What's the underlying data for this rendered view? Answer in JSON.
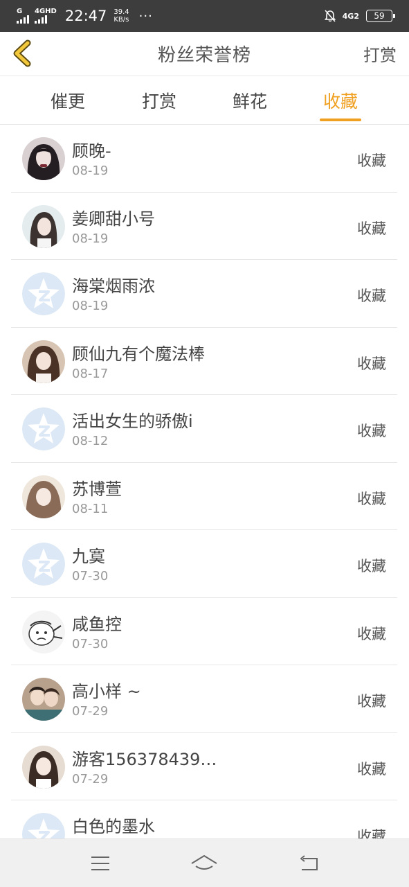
{
  "status_bar": {
    "sim1": "G",
    "sim2": "4GHD",
    "time": "22:47",
    "speed_value": "39.4",
    "speed_unit": "KB/s",
    "more": "···",
    "net": "4G2",
    "battery": "59"
  },
  "header": {
    "title": "粉丝荣誉榜",
    "action": "打赏"
  },
  "tabs": [
    {
      "label": "催更"
    },
    {
      "label": "打赏"
    },
    {
      "label": "鲜花"
    },
    {
      "label": "收藏",
      "active": true
    }
  ],
  "list": [
    {
      "name": "顾晚-",
      "date": "08-19",
      "action": "收藏",
      "avatar": "photo"
    },
    {
      "name": "姜卿甜小号",
      "date": "08-19",
      "action": "收藏",
      "avatar": "photo"
    },
    {
      "name": "海棠烟雨浓",
      "date": "08-19",
      "action": "收藏",
      "avatar": "default"
    },
    {
      "name": "顾仙九有个魔法棒",
      "date": "08-17",
      "action": "收藏",
      "avatar": "photo"
    },
    {
      "name": "活出女生的骄傲i",
      "date": "08-12",
      "action": "收藏",
      "avatar": "default"
    },
    {
      "name": "苏博萱",
      "date": "08-11",
      "action": "收藏",
      "avatar": "photo"
    },
    {
      "name": "九寞",
      "date": "07-30",
      "action": "收藏",
      "avatar": "default"
    },
    {
      "name": "咸鱼控",
      "date": "07-30",
      "action": "收藏",
      "avatar": "photo"
    },
    {
      "name": "高小样 ~",
      "date": "07-29",
      "action": "收藏",
      "avatar": "photo"
    },
    {
      "name": "游客156378439…",
      "date": "07-29",
      "action": "收藏",
      "avatar": "photo"
    },
    {
      "name": "白色的墨水",
      "date": "",
      "action": "收藏",
      "avatar": "default"
    }
  ],
  "colors": {
    "accent": "#f0a020",
    "status_bar": "#3d3d3d",
    "default_avatar": "#dce8f5"
  },
  "icons": {
    "back": "chevron-left-icon",
    "menu": "menu-icon",
    "home": "home-icon",
    "back_nav": "back-arrow-icon"
  }
}
